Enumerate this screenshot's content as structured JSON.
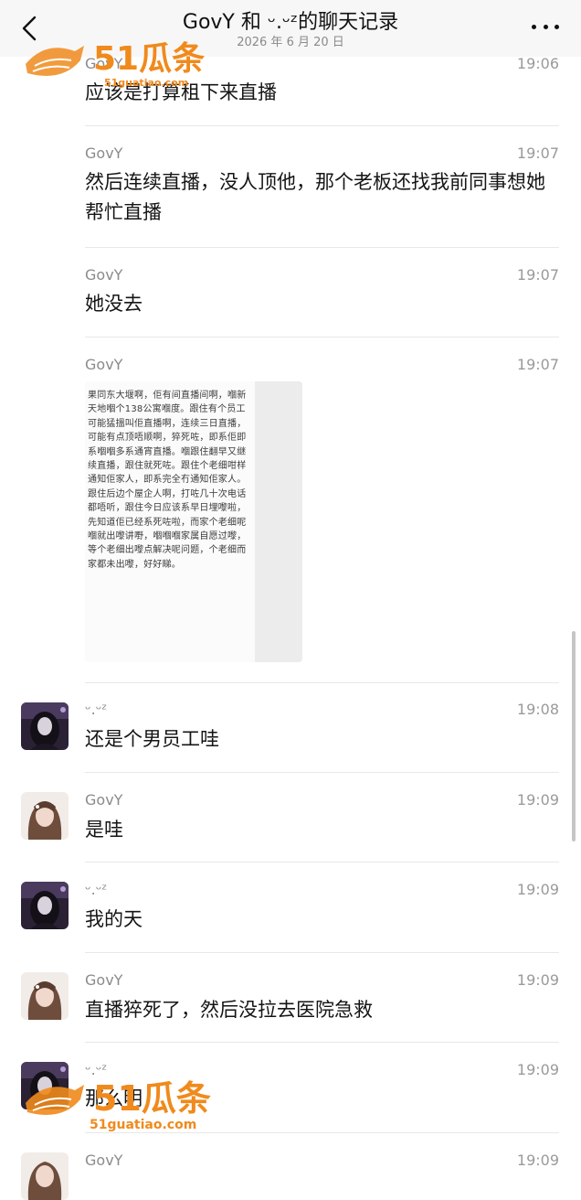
{
  "header": {
    "back_icon": "chevron-left-icon",
    "title": "GovY 和 ᵕ.ᵕᶻ的聊天记录",
    "date": "2026 年 6 月 20 日",
    "more_icon": "more-horizontal-icon"
  },
  "watermark": {
    "brand": "51瓜条",
    "url_top": "51guatiao.com",
    "url_bottom": "51guatiao.com"
  },
  "messages": [
    {
      "sender": "GovY",
      "time": "19:06",
      "text": "应该是打算租下来直播"
    },
    {
      "sender": "GovY",
      "time": "19:07",
      "text": "然后连续直播，没人顶他，那个老板还找我前同事想她帮忙直播"
    },
    {
      "sender": "GovY",
      "time": "19:07",
      "text": "她没去"
    },
    {
      "sender": "GovY",
      "time": "19:07",
      "image_text": "果同东大堰啊，佢有间直播间啊，嗰新天地嗰个138公寓嗰度。跟住有个员工可能猛搵叫佢直播啊，连续三日直播，可能有点顶唔顺啊，猝死咗，即系佢即系嗰嗰多系通宵直播。嗰跟住翻早又继续直播，跟住就死咗。跟住个老细咁样通知佢家人，即系完全冇通知佢家人。跟住后边个屋企人啊，打咗几十次电话都唔听，跟住今日应该系早日埋嚟啦，先知道佢已经系死咗啦，而家个老细呢嗰就出嚟讲嘢，嗰嗰嗰家属自愿过嚟，等个老细出嚟点解决呢问题，个老细而家都未出嚟，好好睇。"
    },
    {
      "sender": "ᵕ.ᵕᶻ",
      "time": "19:08",
      "text": "还是个男员工哇"
    },
    {
      "sender": "GovY",
      "time": "19:09",
      "text": "是哇"
    },
    {
      "sender": "ᵕ.ᵕᶻ",
      "time": "19:09",
      "text": "我的天"
    },
    {
      "sender": "GovY",
      "time": "19:09",
      "text": "直播猝死了，然后没拉去医院急救"
    },
    {
      "sender": "ᵕ.ᵕᶻ",
      "time": "19:09",
      "text": "那么明"
    },
    {
      "sender": "GovY",
      "time": "19:09",
      "text": ""
    }
  ]
}
